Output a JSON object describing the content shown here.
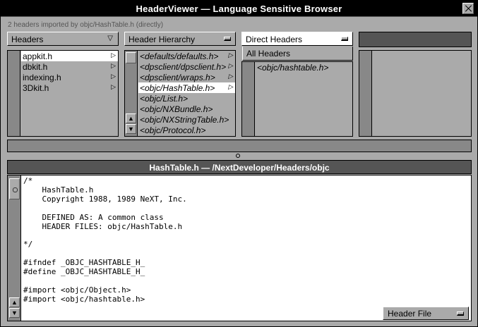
{
  "window": {
    "title": "HeaderViewer — Language Sensitive Browser",
    "status": "2 headers imported by objc/HashTable.h (directly)"
  },
  "popups": {
    "headers": "Headers",
    "hierarchy": "Header Hierarchy",
    "direct": "Direct Headers",
    "menu_option": "All Headers"
  },
  "columns": {
    "files": [
      "appkit.h",
      "dbkit.h",
      "indexing.h",
      "3Dkit.h"
    ],
    "hierarchy": [
      "<defaults/defaults.h>",
      "<dpsclient/dpsclient.h>",
      "<dpsclient/wraps.h>",
      "<objc/HashTable.h>",
      "<objc/List.h>",
      "<objc/NXBundle.h>",
      "<objc/NXStringTable.h>",
      "<objc/Protocol.h>"
    ],
    "direct": [
      "<objc/hashtable.h>"
    ]
  },
  "document": {
    "header": "HashTable.h — /NextDeveloper/Headers/objc",
    "code_lines": [
      "/*",
      "    HashTable.h",
      "    Copyright 1988, 1989 NeXT, Inc.",
      "",
      "    DEFINED AS: A common class",
      "    HEADER FILES: objc/HashTable.h",
      "",
      "*/",
      "",
      "#ifndef _OBJC_HASHTABLE_H_",
      "#define _OBJC_HASHTABLE_H_",
      "",
      "#import <objc/Object.h>",
      "#import <objc/hashtable.h>",
      ""
    ],
    "file_popup": "Header File"
  },
  "icons": {
    "close": "close-icon",
    "branch": "right-triangle-icon",
    "scroll_up": "up-arrow-icon",
    "scroll_down": "down-arrow-icon"
  }
}
